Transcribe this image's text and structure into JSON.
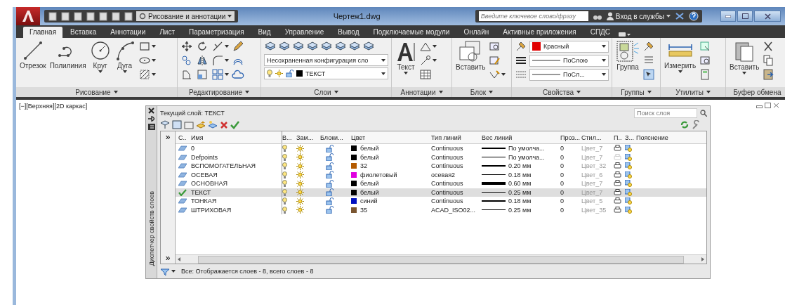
{
  "title_bar": {
    "workspace": "Рисование и аннотации",
    "title": "Чертеж1.dwg",
    "search_placeholder": "Введите ключевое слово/фразу",
    "sign_in": "Вход в службы"
  },
  "tabs": [
    {
      "label": "Главная",
      "selected": true
    },
    {
      "label": "Вставка",
      "selected": false
    },
    {
      "label": "Аннотации",
      "selected": false
    },
    {
      "label": "Лист",
      "selected": false
    },
    {
      "label": "Параметризация",
      "selected": false
    },
    {
      "label": "Вид",
      "selected": false
    },
    {
      "label": "Управление",
      "selected": false
    },
    {
      "label": "Вывод",
      "selected": false
    },
    {
      "label": "Подключаемые модули",
      "selected": false
    },
    {
      "label": "Онлайн",
      "selected": false
    },
    {
      "label": "Активные приложения",
      "selected": false
    },
    {
      "label": "СПДС",
      "selected": false
    }
  ],
  "ribbon": {
    "panels": [
      {
        "kind": "draw",
        "title": "Рисование",
        "has_menu": true,
        "buttons": [
          "Отрезок",
          "Полилиния",
          "Круг",
          "Дуга"
        ]
      },
      {
        "kind": "modify",
        "title": "Редактирование",
        "has_menu": true
      },
      {
        "kind": "layers",
        "title": "Слои",
        "has_menu": true,
        "state_dropdown": "Несохраненная конфигурация сло",
        "layer_dropdown": "ТЕКСТ"
      },
      {
        "kind": "annotation",
        "title": "Аннотации",
        "has_menu": true,
        "buttons": [
          "Текст"
        ]
      },
      {
        "kind": "block",
        "title": "Блок",
        "has_menu": true,
        "buttons": [
          "Вставить"
        ]
      },
      {
        "kind": "properties",
        "title": "Свойства",
        "has_menu": true,
        "color_dropdown": "Красный",
        "lineweight": "ПоСлою",
        "linetype": "ПоСл..."
      },
      {
        "kind": "groups",
        "title": "Группы",
        "has_menu": true,
        "buttons": [
          "Группа"
        ]
      },
      {
        "kind": "utilities",
        "title": "Утилиты",
        "has_menu": true,
        "buttons": [
          "Измерить"
        ]
      },
      {
        "kind": "clipboard",
        "title": "Буфер обмена",
        "has_menu": false,
        "buttons": [
          "Вставить"
        ]
      }
    ]
  },
  "viewport": {
    "label": "[−][Верхняя][2D каркас]"
  },
  "layer_manager": {
    "filter_toggles": [
      "»",
      "»"
    ],
    "side_title": "Диспетчер свойств слоев",
    "current_layer": "Текущий слой: ТЕКСТ",
    "search_placeholder": "Поиск слоя",
    "status": "Все: Отображается слоев - 8, всего слоев - 8",
    "columns": [
      "С..",
      "Имя",
      "В...",
      "Зам...",
      "Блоки...",
      "Цвет",
      "Тип линий",
      "Вес линий",
      "Проз...",
      "Стил...",
      "П..",
      "З...",
      "Пояснение"
    ],
    "rows": [
      {
        "current": false,
        "selected": false,
        "name": "0",
        "on": true,
        "frozen": false,
        "locked": false,
        "color": "#000000",
        "color_name": "белый",
        "linetype": "Continuous",
        "kind": "medium",
        "lineweight": "По умолча...",
        "transparency": "0",
        "plot_style": "Цвет_7",
        "plot": true
      },
      {
        "current": false,
        "selected": false,
        "name": "Defpoints",
        "on": true,
        "frozen": false,
        "locked": false,
        "color": "#000000",
        "color_name": "белый",
        "linetype": "Continuous",
        "kind": "thin",
        "lineweight": "По умолча...",
        "transparency": "0",
        "plot_style": "Цвет_7",
        "plot": false
      },
      {
        "current": false,
        "selected": false,
        "name": "ВСПОМОГАТЕЛЬНАЯ",
        "on": true,
        "frozen": false,
        "locked": false,
        "color": "#b35a00",
        "color_name": "32",
        "linetype": "Continuous",
        "kind": "medium",
        "lineweight": "0.20 мм",
        "transparency": "0",
        "plot_style": "Цвет_32",
        "plot": true
      },
      {
        "current": false,
        "selected": false,
        "name": "ОСЕВАЯ",
        "on": true,
        "frozen": false,
        "locked": false,
        "color": "#e000e0",
        "color_name": "фиолетовый",
        "linetype": "осевая2",
        "kind": "thin",
        "lineweight": "0.18 мм",
        "transparency": "0",
        "plot_style": "Цвет_6",
        "plot": true
      },
      {
        "current": false,
        "selected": false,
        "name": "ОСНОВНАЯ",
        "on": true,
        "frozen": false,
        "locked": false,
        "color": "#000000",
        "color_name": "белый",
        "linetype": "Continuous",
        "kind": "thick",
        "lineweight": "0.60 мм",
        "transparency": "0",
        "plot_style": "Цвет_7",
        "plot": true
      },
      {
        "current": true,
        "selected": true,
        "name": "ТЕКСТ",
        "on": true,
        "frozen": false,
        "locked": false,
        "color": "#000000",
        "color_name": "белый",
        "linetype": "Continuous",
        "kind": "thin",
        "lineweight": "0.25 мм",
        "transparency": "0",
        "plot_style": "Цвет_7",
        "plot": true
      },
      {
        "current": false,
        "selected": false,
        "name": "ТОНКАЯ",
        "on": true,
        "frozen": false,
        "locked": false,
        "color": "#0010c0",
        "color_name": "синий",
        "linetype": "Continuous",
        "kind": "medium",
        "lineweight": "0.18 мм",
        "transparency": "0",
        "plot_style": "Цвет_5",
        "plot": true
      },
      {
        "current": false,
        "selected": false,
        "name": "ШТРИХОВАЯ",
        "on": true,
        "frozen": false,
        "locked": false,
        "color": "#7a5530",
        "color_name": "35",
        "linetype": "ACAD_ISO02...",
        "kind": "thin",
        "lineweight": "0.25 мм",
        "transparency": "0",
        "plot_style": "Цвет_35",
        "plot": true
      }
    ]
  }
}
